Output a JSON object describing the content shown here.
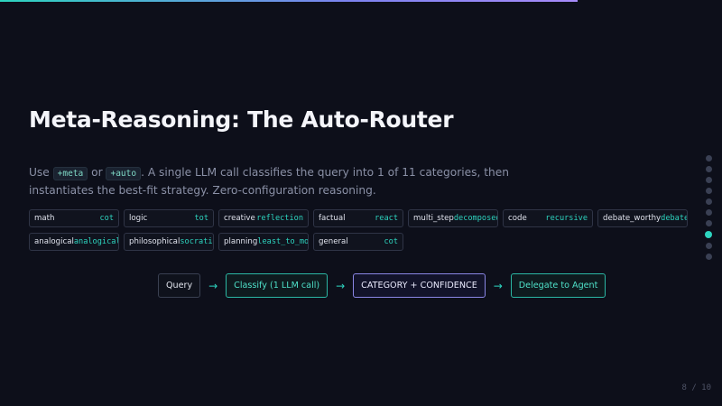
{
  "slide": {
    "title": "Meta-Reasoning: The Auto-Router",
    "desc_use": "Use",
    "code_meta": "+meta",
    "desc_or": "or",
    "code_auto": "+auto",
    "desc_rest": ". A single LLM call classifies the query into 1 of 11 categories, then instantiates the best-fit strategy. Zero-configuration reasoning."
  },
  "categories_row1": [
    {
      "category": "math",
      "strategy": "cot"
    },
    {
      "category": "logic",
      "strategy": "tot"
    },
    {
      "category": "creative",
      "strategy": "reflection"
    },
    {
      "category": "factual",
      "strategy": "react"
    },
    {
      "category": "multi_step",
      "strategy": "decomposed"
    },
    {
      "category": "code",
      "strategy": "recursive"
    },
    {
      "category": "debate_worthy",
      "strategy": "debate"
    }
  ],
  "categories_row2": [
    {
      "category": "analogical",
      "strategy": "analogical"
    },
    {
      "category": "philosophical",
      "strategy": "socratic"
    },
    {
      "category": "planning",
      "strategy": "least_to_most"
    },
    {
      "category": "general",
      "strategy": "cot"
    }
  ],
  "flow": {
    "query": "Query",
    "classify": "Classify (1 LLM call)",
    "category": "CATEGORY + CONFIDENCE",
    "delegate": "Delegate to Agent",
    "arrow": "→"
  },
  "nav": {
    "total_dots": 10,
    "active_index": 8,
    "page_label": "8 / 10"
  },
  "colors": {
    "accent": "#2dd4bf",
    "violet": "#8a86e6",
    "background": "#0d0f1a"
  }
}
